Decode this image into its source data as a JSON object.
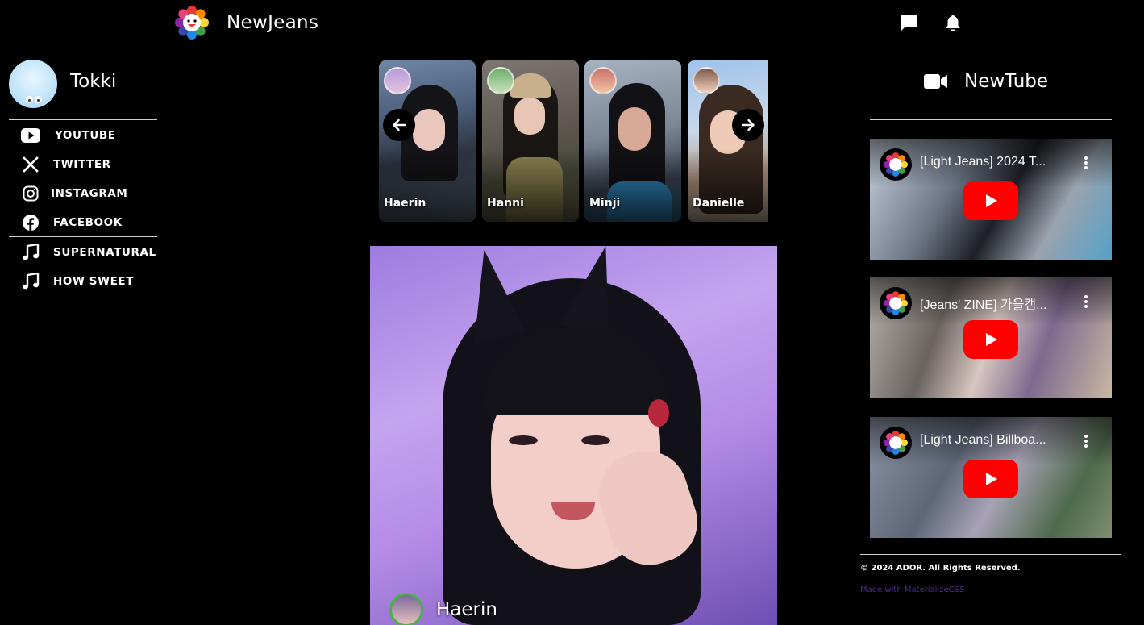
{
  "header": {
    "brand": "NewJeans",
    "logo_icon": "flower-logo-icon",
    "icons": [
      "chat-icon",
      "notification-bell-icon"
    ]
  },
  "profile": {
    "name": "Tokki",
    "avatar_icon": "tokki-bunny-avatar"
  },
  "sidebar": {
    "items": [
      {
        "label": "YOUTUBE",
        "icon": "youtube-icon"
      },
      {
        "label": "TWITTER",
        "icon": "x-twitter-icon"
      },
      {
        "label": "INSTAGRAM",
        "icon": "instagram-icon"
      },
      {
        "label": "FACEBOOK",
        "icon": "facebook-icon"
      },
      {
        "label": "SUPERNATURAL",
        "icon": "music-note-icon"
      },
      {
        "label": "HOW SWEET",
        "icon": "music-note-icon"
      }
    ]
  },
  "stories": {
    "items": [
      {
        "name": "Haerin"
      },
      {
        "name": "Hanni"
      },
      {
        "name": "Minji"
      },
      {
        "name": "Danielle"
      }
    ],
    "prev_icon": "arrow-left-icon",
    "next_icon": "arrow-right-icon"
  },
  "post": {
    "author": "Haerin"
  },
  "newtube": {
    "title": "NewTube",
    "icon": "video-camera-icon",
    "videos": [
      {
        "title": "[Light Jeans] 2024 T..."
      },
      {
        "title": "[Jeans' ZINE] 가을캠..."
      },
      {
        "title": "[Light Jeans] Billboa..."
      }
    ]
  },
  "footer": {
    "copyright": "© 2024 ADOR. All Rights Reserved.",
    "made_with": "Made with MaterializeCSS"
  },
  "colors": {
    "background": "#000000",
    "divider": "#cfcfcf",
    "play_button": "#ff0000",
    "footer_link": "#4a2d86"
  }
}
